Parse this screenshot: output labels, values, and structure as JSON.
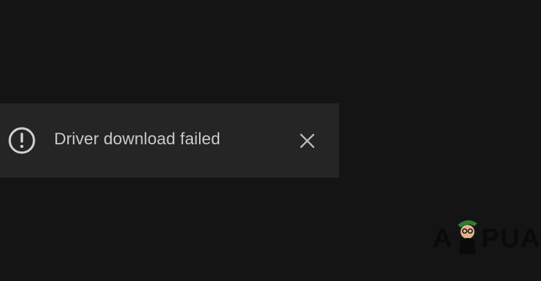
{
  "notification": {
    "icon": "alert-circle-icon",
    "message": "Driver download failed",
    "close_icon": "close-icon",
    "colors": {
      "background": "#252525",
      "text": "#c9c9c9",
      "icon": "#d0d0d0"
    }
  },
  "watermark": {
    "text_left": "A",
    "text_right": "PUA",
    "logo_icon": "appuals-mascot-icon",
    "accent": "#2e7d32"
  },
  "page": {
    "background": "#141414"
  }
}
